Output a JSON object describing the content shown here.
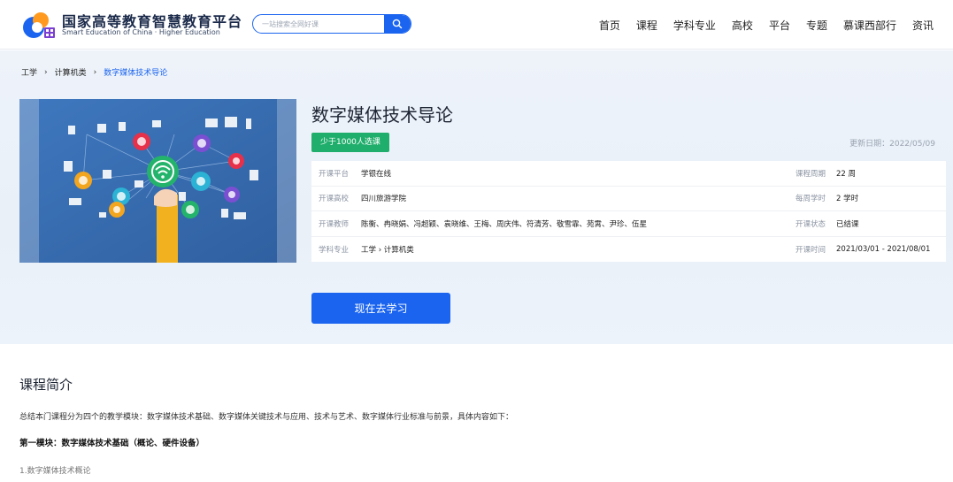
{
  "brand": {
    "name_cn": "国家高等教育智慧教育平台",
    "name_en": "Smart Education of China · Higher Education"
  },
  "search": {
    "placeholder": "一站搜索全网好课"
  },
  "nav": [
    "首页",
    "课程",
    "学科专业",
    "高校",
    "平台",
    "专题",
    "慕课西部行",
    "资讯"
  ],
  "breadcrumb": [
    "工学",
    "计算机类",
    "数字媒体技术导论"
  ],
  "course": {
    "title": "数字媒体技术导论",
    "enroll_badge": "少于1000人选课",
    "update_date": "更新日期：2022/05/09",
    "info": {
      "platform_label": "开课平台",
      "platform": "学银在线",
      "school_label": "开课高校",
      "school": "四川旅游学院",
      "teachers_label": "开课教师",
      "teachers": "陈衡、冉晓娟、冯超颖、袁晓维、王梅、周庆伟、符清芳、敬雪霏、苑霄、尹珍、伍星",
      "major_label": "学科专业",
      "major": "工学 › 计算机类",
      "period_label": "课程周期",
      "period": "22 周",
      "hours_label": "每周学时",
      "hours": "2 学时",
      "status_label": "开课状态",
      "status": "已结课",
      "time_label": "开课时间",
      "time": "2021/03/01 - 2021/08/01"
    },
    "study_button": "现在去学习"
  },
  "intro": {
    "heading": "课程简介",
    "text": "总结本门课程分为四个的教学模块：数字媒体技术基础、数字媒体关键技术与应用、技术与艺术、数字媒体行业标准与前景，具体内容如下：",
    "module1_title": "第一模块：数字媒体技术基础（概论、硬件设备）",
    "module1_item1": "1.数字媒体技术概论"
  },
  "colors": {
    "primary": "#1a64f0",
    "badge": "#1fae6b"
  },
  "icons": [
    "logo-icon",
    "search-icon",
    "chevron-right-icon",
    "course-cover-image"
  ]
}
